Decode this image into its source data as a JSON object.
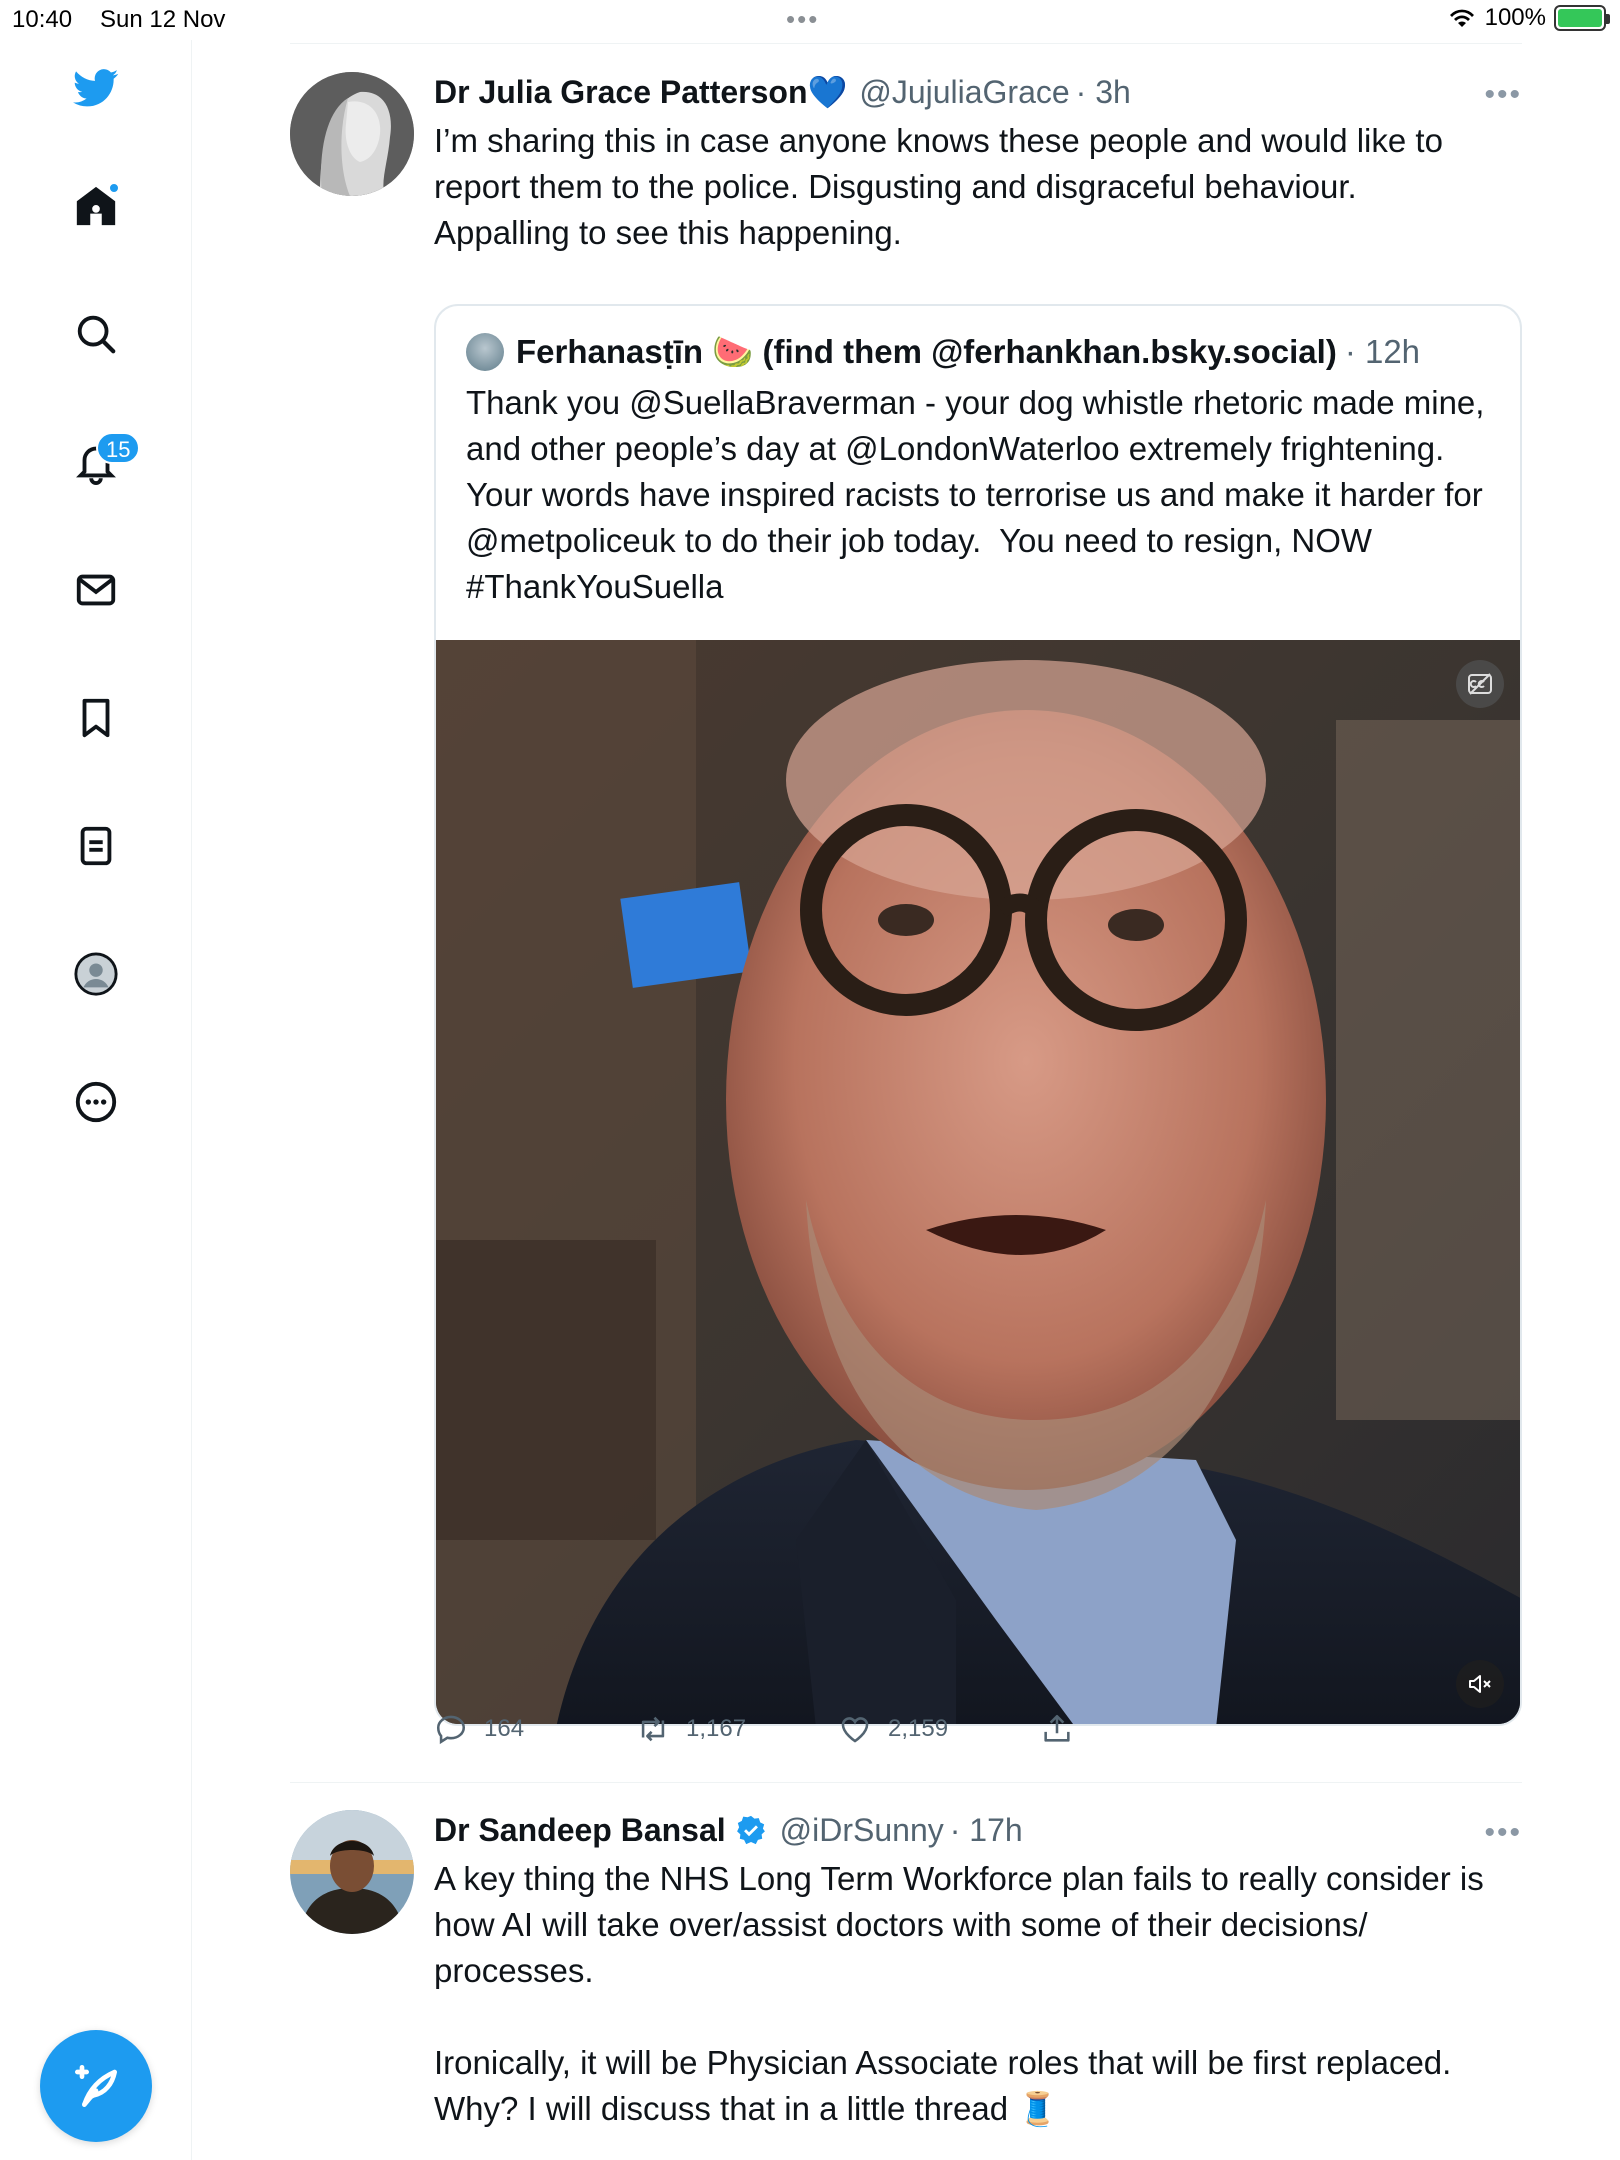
{
  "status_bar": {
    "time": "10:40",
    "date": "Sun 12 Nov",
    "battery": "100%"
  },
  "sidebar": {
    "items": [
      {
        "icon": "twitter-logo-icon"
      },
      {
        "icon": "home-icon"
      },
      {
        "icon": "search-icon"
      },
      {
        "icon": "notifications-icon",
        "badge": "15"
      },
      {
        "icon": "messages-icon"
      },
      {
        "icon": "bookmarks-icon"
      },
      {
        "icon": "lists-icon"
      },
      {
        "icon": "profile-icon"
      },
      {
        "icon": "more-icon"
      }
    ],
    "compose_icon": "compose-tweet-icon"
  },
  "tweets": [
    {
      "name": "Dr Julia Grace Patterson",
      "emoji": "💙",
      "handle": "@JujuliaGrace",
      "time": "· 3h",
      "text": "I’m sharing this in case anyone knows these people and would like to report them to the police. Disgusting and disgraceful behaviour. Appalling to see this happening.",
      "quote": {
        "name": "Ferhanasṭīn 🍉 (find them @ferhankhan.bsky.social)",
        "time": "· 12h",
        "text": "Thank you @SuellaBraverman - your dog whistle rhetoric made mine, and other people’s day at @LondonWaterloo extremely frightening.  Your words have inspired racists to terrorise us and make it harder for @metpoliceuk to do their job today.  You need to resign, NOW #ThankYouSuella"
      },
      "replies": "164",
      "retweets": "1,167",
      "likes": "2,159"
    },
    {
      "name": "Dr Sandeep Bansal",
      "handle": "@iDrSunny",
      "time": "· 17h",
      "text": "A key thing the NHS Long Term Workforce plan fails to really consider is how AI will take over/assist doctors with some of their decisions/ processes.\n\nIronically, it will be Physician Associate roles that will be first replaced. Why? I will discuss that in a little thread 🧵"
    }
  ],
  "colors": {
    "accent": "#1d9bf0",
    "text": "#0f1419",
    "secondary": "#536471",
    "border": "#eff3f4"
  }
}
